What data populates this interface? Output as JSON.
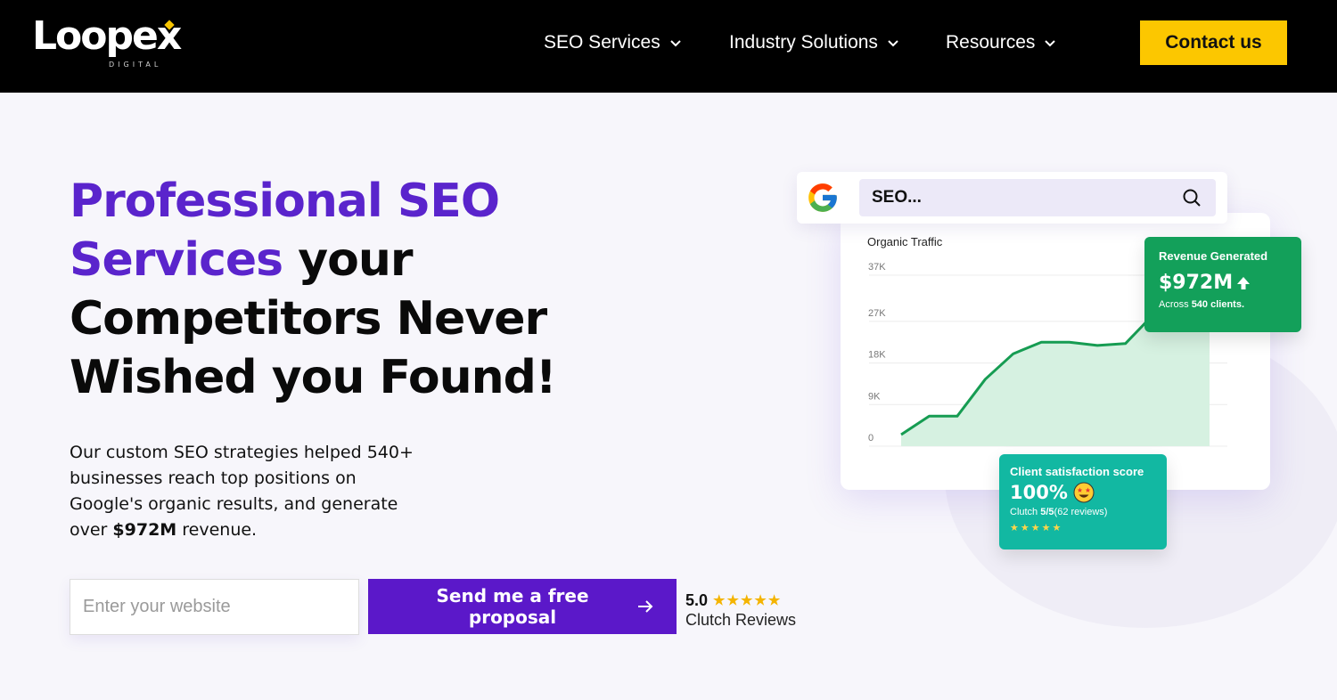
{
  "nav": {
    "logo_text": "Loopex",
    "logo_sub": "DIGITAL",
    "items": [
      {
        "label": "SEO Services"
      },
      {
        "label": "Industry Solutions"
      },
      {
        "label": "Resources"
      }
    ],
    "contact_label": "Contact us"
  },
  "hero": {
    "headline_accent": "Professional SEO Services",
    "headline_rest": " your Competitors Never Wished you Found!",
    "sub_pre": "Our custom SEO strategies helped 540+ businesses reach top positions on Google's organic results, and generate over ",
    "sub_bold": "$972M",
    "sub_post": " revenue."
  },
  "cta": {
    "input_placeholder": "Enter your website",
    "button_label": "Send me a free proposal",
    "rating_value": "5.0",
    "rating_stars": 5,
    "rating_label": "Clutch Reviews"
  },
  "search": {
    "query": "SEO..."
  },
  "revenue_badge": {
    "label": "Revenue Generated",
    "value": "$972M",
    "foot_pre": "Across ",
    "foot_bold": "540 clients.",
    "accent_color": "#13a05a"
  },
  "satisfaction_badge": {
    "label": "Client satisfaction score",
    "value": "100%",
    "foot_pre": "Clutch ",
    "foot_bold": "5/5",
    "foot_post": "(62 reviews)",
    "stars": 5,
    "accent_color": "#12b8a2"
  },
  "chart_data": {
    "type": "area",
    "title": "Organic Traffic",
    "y_ticks": [
      "0",
      "9K",
      "18K",
      "27K",
      "37K"
    ],
    "ylim": [
      0,
      37000
    ],
    "values": [
      2500,
      6500,
      6500,
      14500,
      20000,
      22500,
      22500,
      21800,
      22200,
      28500,
      35500,
      35000
    ],
    "line_color": "#169c52",
    "fill_color": "#d6f1e1"
  },
  "colors": {
    "brand_purple": "#5b18c9",
    "nav_bg": "#000000",
    "contact_yellow": "#fcc700"
  }
}
